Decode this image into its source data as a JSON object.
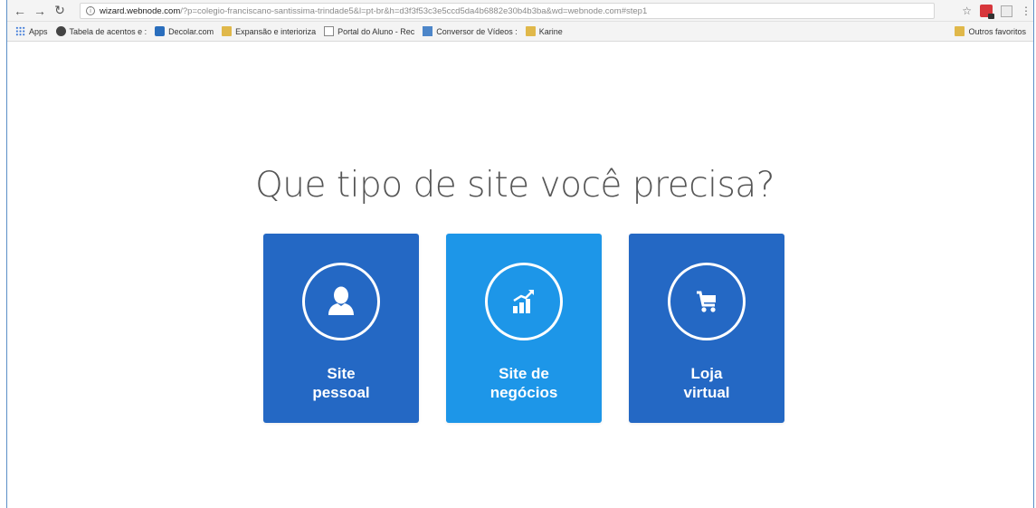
{
  "browser": {
    "url_host": "wizard.webnode.com",
    "url_path": "/?p=colegio-franciscano-santissima-trindade5&l=pt-br&h=d3f3f53c3e5ccd5da4b6882e30b4b3ba&wd=webnode.com#step1",
    "bookmarks": [
      {
        "label": "Apps",
        "icon": "apps-grid-icon"
      },
      {
        "label": "Tabela de acentos e :",
        "icon": "globe-icon"
      },
      {
        "label": "Decolar.com",
        "icon": "decolar-icon"
      },
      {
        "label": "Expansão e interioriza",
        "icon": "folder-icon"
      },
      {
        "label": "Portal do Aluno - Rec",
        "icon": "document-icon"
      },
      {
        "label": "Conversor de Vídeos :",
        "icon": "converter-icon"
      },
      {
        "label": "Karine",
        "icon": "folder-icon"
      }
    ],
    "other_bookmarks": "Outros favoritos"
  },
  "page": {
    "headline": "Que tipo de site você precisa?",
    "options": [
      {
        "label": "Site\npessoal",
        "icon": "person-icon",
        "color": "#2468c4"
      },
      {
        "label": "Site de\nnegócios",
        "icon": "growth-chart-icon",
        "color": "#1d96e8"
      },
      {
        "label": "Loja\nvirtual",
        "icon": "shopping-cart-icon",
        "color": "#2468c4"
      }
    ]
  }
}
